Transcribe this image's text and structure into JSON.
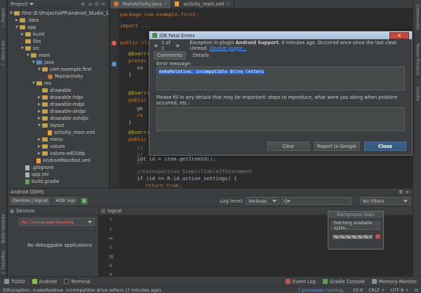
{
  "left_strip": {
    "tabs": [
      {
        "num": "1:",
        "label": "Project"
      },
      {
        "num": "7:",
        "label": "Structure"
      },
      {
        "num": "",
        "label": "Build Variants"
      },
      {
        "num": "2:",
        "label": "Favorites"
      }
    ]
  },
  "right_strip": {
    "tabs": [
      "Commander",
      "Maven Projects",
      "Gradle"
    ]
  },
  "project": {
    "header": "Project",
    "tree": [
      {
        "label": "First (E:\\Project\\APP\\Android_Studio_1.0\\...",
        "depth": 0,
        "kind": "folder",
        "arrow": "▼"
      },
      {
        "label": ".idea",
        "depth": 1,
        "kind": "folder",
        "arrow": "▶"
      },
      {
        "label": "app",
        "depth": 1,
        "kind": "folder",
        "arrow": "▼"
      },
      {
        "label": "build",
        "depth": 2,
        "kind": "folder",
        "arrow": "▶"
      },
      {
        "label": "libs",
        "depth": 2,
        "kind": "folder",
        "arrow": ""
      },
      {
        "label": "src",
        "depth": 2,
        "kind": "folder",
        "arrow": "▼"
      },
      {
        "label": "main",
        "depth": 3,
        "kind": "folder",
        "arrow": "▼"
      },
      {
        "label": "java",
        "depth": 4,
        "kind": "folder-blue",
        "arrow": "▼"
      },
      {
        "label": "com.example.first",
        "depth": 5,
        "kind": "folder",
        "arrow": "▼"
      },
      {
        "label": "MainActivity",
        "depth": 6,
        "kind": "java",
        "arrow": ""
      },
      {
        "label": "res",
        "depth": 4,
        "kind": "folder",
        "arrow": "▼"
      },
      {
        "label": "drawable",
        "depth": 5,
        "kind": "folder",
        "arrow": ""
      },
      {
        "label": "drawable-hdpi",
        "depth": 5,
        "kind": "folder",
        "arrow": "▶"
      },
      {
        "label": "drawable-mdpi",
        "depth": 5,
        "kind": "folder",
        "arrow": "▶"
      },
      {
        "label": "drawable-xhdpi",
        "depth": 5,
        "kind": "folder",
        "arrow": "▶"
      },
      {
        "label": "drawable-xxhdpi",
        "depth": 5,
        "kind": "folder",
        "arrow": "▶"
      },
      {
        "label": "layout",
        "depth": 5,
        "kind": "folder",
        "arrow": "▼"
      },
      {
        "label": "activity_main.xml",
        "depth": 6,
        "kind": "xml",
        "arrow": ""
      },
      {
        "label": "menu",
        "depth": 5,
        "kind": "folder",
        "arrow": "▶"
      },
      {
        "label": "values",
        "depth": 5,
        "kind": "folder",
        "arrow": "▶"
      },
      {
        "label": "values-w820dp",
        "depth": 5,
        "kind": "folder",
        "arrow": "▶"
      },
      {
        "label": "AndroidManifest.xml",
        "depth": 4,
        "kind": "xml",
        "arrow": ""
      },
      {
        "label": ".gitignore",
        "depth": 2,
        "kind": "file",
        "arrow": ""
      },
      {
        "label": "app.iml",
        "depth": 2,
        "kind": "file",
        "arrow": ""
      },
      {
        "label": "build.gradle",
        "depth": 2,
        "kind": "gradle",
        "arrow": ""
      }
    ]
  },
  "editor": {
    "tabs": [
      {
        "label": "MainActivity.java",
        "active": true
      },
      {
        "label": "activity_main.xml",
        "active": false
      }
    ]
  },
  "code": [
    {
      "html_key": "l1",
      "text": "package com.example.first;"
    },
    {
      "text": "import ..."
    },
    {
      "text": "public cla"
    },
    {
      "text": "@Overri"
    },
    {
      "text": "protec"
    },
    {
      "text": "su"
    },
    {
      "text": "}"
    },
    {
      "text": "@Overri"
    },
    {
      "text": "public"
    },
    {
      "text": "ge"
    },
    {
      "text": "re"
    },
    {
      "text": "}"
    },
    {
      "text": "@Overri"
    },
    {
      "text": "public"
    },
    {
      "text": "//"
    },
    {
      "text": "//"
    },
    {
      "text": "//"
    },
    {
      "text": "int id = item.getItemId();"
    },
    {
      "text": "//noinspection SimplifiableIfStatement"
    },
    {
      "text": "if (id == R.id.action_settings) {"
    },
    {
      "text": "return true;"
    },
    {
      "text": "}"
    }
  ],
  "modal": {
    "title": "IDE Fatal Errors",
    "counter": "1 of 1",
    "message_prefix": "Exception in plugin",
    "plugin_name": "Android Support",
    "message_suffix": ". 4 minutes ago. Occurred once since the last clear. Unread.",
    "disable_link": "Disable plugin...",
    "tabs": [
      "Comments",
      "Details"
    ],
    "error_label": "Error message:",
    "error_text": "makeRelative: incompatible drive letters",
    "details_label": "Please fill in any details that may be important: steps to reproduce, what were you doing when problem occurred, etc.:",
    "buttons": {
      "clear": "Clear",
      "report": "Report to Google",
      "close": "Close"
    }
  },
  "ddms": {
    "title": "Android DDMS",
    "tabs": [
      "Devices | logcat",
      "ADB logs"
    ],
    "log_level_label": "Log level:",
    "log_level": "Verbose",
    "search_placeholder": "Q▾",
    "filter": "No Filters",
    "devices_header": "Devices",
    "no_devices": "No Connected Devices",
    "no_apps": "No debuggable applications",
    "logcat_header": "logcat"
  },
  "bg_tasks": {
    "title": "Background Tasks",
    "fetching": "Fetching available syste..."
  },
  "bottom_tools": [
    {
      "num": "6:",
      "label": "TODO"
    },
    {
      "num": "6:",
      "label": "Android"
    },
    {
      "num": "",
      "label": "Terminal"
    }
  ],
  "bottom_right_tools": [
    "Event Log",
    "Gradle Console",
    "Memory Monitor"
  ],
  "status": {
    "message": "IOException: makeRelative: incompatible drive letters (7 minutes ago)",
    "processes": "7 processes running...",
    "position": "15:6",
    "line_sep": "CRLF ÷",
    "encoding": "UTF-8 ÷"
  },
  "colors": {
    "accent": "#2f65ca",
    "error_red": "#ff6b6b",
    "link": "#589df6"
  }
}
